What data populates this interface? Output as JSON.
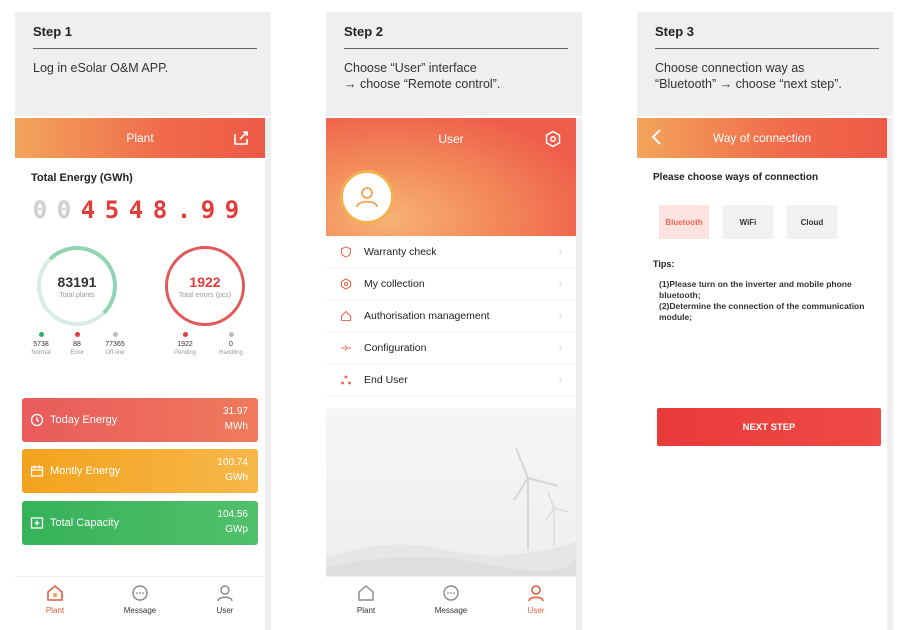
{
  "steps": [
    {
      "title": "Step 1",
      "description": "Log in eSolar O&M APP."
    },
    {
      "title": "Step 2",
      "description": "Choose “User” interface\n→ choose “Remote control”."
    },
    {
      "title": "Step 3",
      "description": "Choose connection way as\n“Bluetooth” → choose “next step”."
    }
  ],
  "screen1": {
    "header_title": "Plant",
    "total_energy_label": "Total Energy (GWh)",
    "digits": [
      {
        "char": "0",
        "dim": true
      },
      {
        "char": "0",
        "dim": true
      },
      {
        "char": "4",
        "dim": false
      },
      {
        "char": "5",
        "dim": false
      },
      {
        "char": "4",
        "dim": false
      },
      {
        "char": "8",
        "dim": false
      },
      {
        "char": ".",
        "dim": false
      },
      {
        "char": "9",
        "dim": false
      },
      {
        "char": "9",
        "dim": false
      }
    ],
    "total_plants": {
      "value": "83191",
      "label": "Total plants"
    },
    "total_errors": {
      "value": "1922",
      "label": "Total errors (pcs)"
    },
    "stats": [
      {
        "value": "5738",
        "label": "Normal",
        "color": "#2fae66"
      },
      {
        "value": "88",
        "label": "Error",
        "color": "#e43b3b"
      },
      {
        "value": "77365",
        "label": "Off-line",
        "color": "#bbbbbb"
      },
      {
        "value": "1922",
        "label": "Pending",
        "color": "#e43b3b"
      },
      {
        "value": "0",
        "label": "Handling",
        "color": "#bbbbbb"
      }
    ],
    "cards": {
      "today": {
        "label": "Today Energy",
        "value": "31.97",
        "unit": "MWh"
      },
      "monthly": {
        "label": "Montly Energy",
        "value": "100.74",
        "unit": "GWh"
      },
      "capacity": {
        "label": "Total Capacity",
        "value": "104.56",
        "unit": "GWp"
      }
    },
    "tabs": {
      "plant": "Plant",
      "message": "Message",
      "user": "User"
    }
  },
  "screen2": {
    "header_title": "User",
    "menu": {
      "warranty": "Warranty check",
      "collection": "My collection",
      "authorisation": "Authorisation management",
      "configuration": "Configuration",
      "end_user": "End User"
    },
    "tabs": {
      "plant": "Plant",
      "message": "Message",
      "user": "User"
    }
  },
  "screen3": {
    "header_title": "Way of connection",
    "prompt": "Please choose ways of connection",
    "options": {
      "bluetooth": "Bluetooth",
      "wifi": "WiFi",
      "cloud": "Cloud"
    },
    "tips_title": "Tips:",
    "tips": [
      "(1)Please turn on the inverter and mobile phone bluetooth;",
      "(2)Determine the connection of the communication module;"
    ],
    "next_button": "NEXT STEP"
  },
  "colors": {
    "accent": "#ee5a48",
    "error": "#e43b3b",
    "success": "#35b25a",
    "warning": "#f3a21d"
  }
}
